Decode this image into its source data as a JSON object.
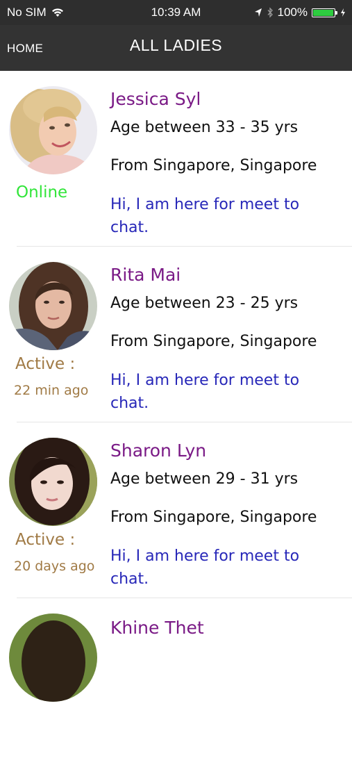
{
  "status_bar": {
    "carrier": "No SIM",
    "time": "10:39 AM",
    "battery": "100%",
    "battery_level": 1.0
  },
  "nav": {
    "home_label": "HOME",
    "title": "ALL LADIES"
  },
  "profiles": [
    {
      "name": "Jessica Syl",
      "age": "Age between 33 - 35 yrs",
      "location": "From Singapore, Singapore",
      "message": "Hi, I am here for meet to chat.",
      "status": "Online",
      "status_time": ""
    },
    {
      "name": "Rita Mai",
      "age": "Age between 23 - 25 yrs",
      "location": "From Singapore, Singapore",
      "message": "Hi, I am here for meet to chat.",
      "status": "Active :",
      "status_time": "22 min ago"
    },
    {
      "name": "Sharon Lyn",
      "age": "Age between 29 - 31 yrs",
      "location": "From Singapore, Singapore",
      "message": "Hi, I am here for meet to chat.",
      "status": "Active :",
      "status_time": "20 days ago"
    },
    {
      "name": "Khine Thet"
    }
  ],
  "colors": {
    "bar_background": "#333333",
    "name": "#7a1a86",
    "message": "#2727b8",
    "online": "#32e53a",
    "active": "#a07a45",
    "battery_fill": "#2ecc40"
  }
}
